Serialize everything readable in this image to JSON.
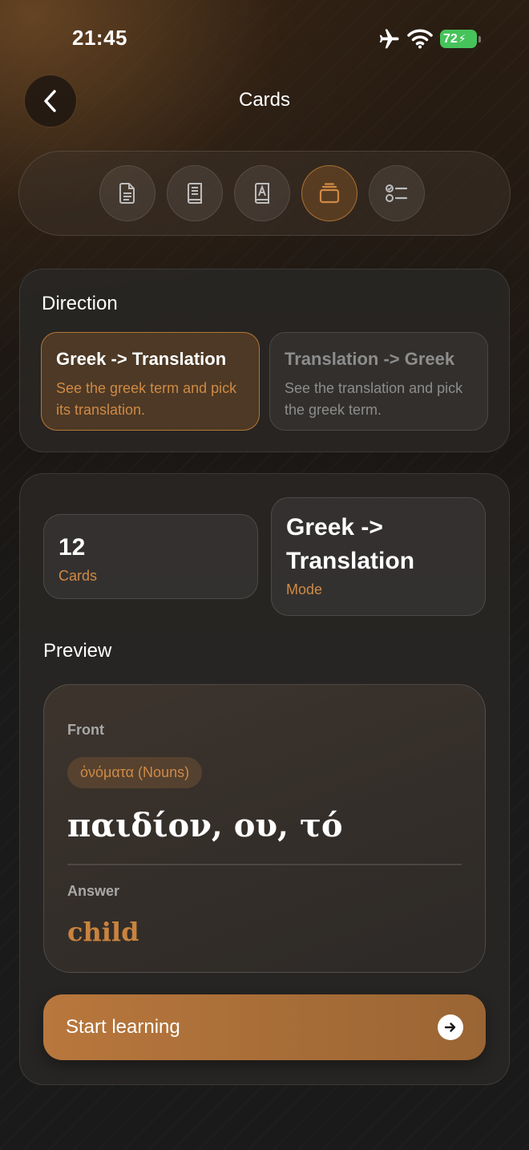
{
  "status_bar": {
    "time": "21:45",
    "battery": "72"
  },
  "header": {
    "title": "Cards"
  },
  "modes": [
    {
      "name": "document",
      "active": false
    },
    {
      "name": "book",
      "active": false
    },
    {
      "name": "dictionary",
      "active": false
    },
    {
      "name": "cards",
      "active": true
    },
    {
      "name": "checklist",
      "active": false
    }
  ],
  "direction": {
    "title": "Direction",
    "options": [
      {
        "title": "Greek -> Translation",
        "desc": "See the greek term and pick its translation.",
        "selected": true
      },
      {
        "title": "Translation -> Greek",
        "desc": "See the translation and pick the greek term.",
        "selected": false
      }
    ]
  },
  "stats": {
    "count": "12",
    "count_label": "Cards",
    "mode": "Greek -> Translation",
    "mode_label": "Mode"
  },
  "preview": {
    "title": "Preview",
    "front_label": "Front",
    "category": "ὀνόματα (Nouns)",
    "term": "παιδίον, ου, τό",
    "answer_label": "Answer",
    "answer": "child"
  },
  "start_button": {
    "label": "Start learning"
  },
  "colors": {
    "accent": "#d08a45",
    "background": "#1a1a1a",
    "battery": "#46c35a"
  }
}
